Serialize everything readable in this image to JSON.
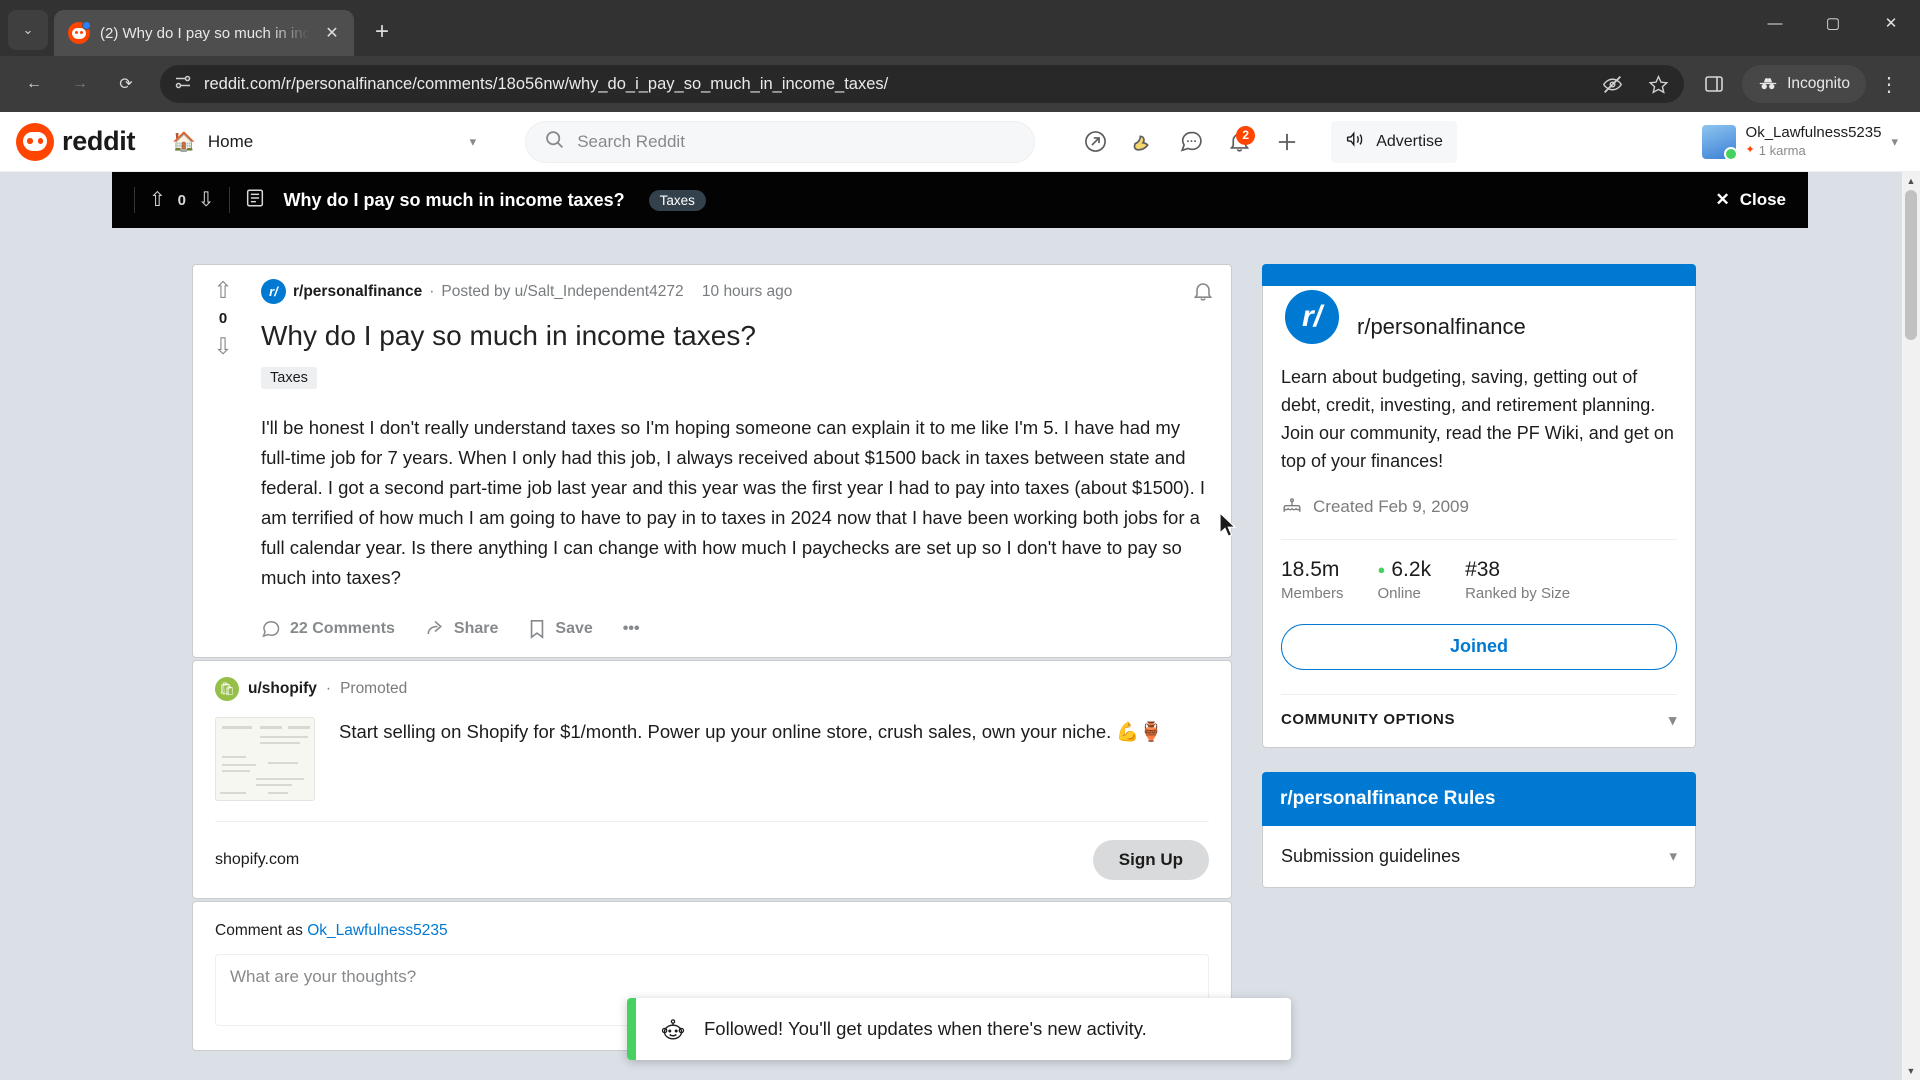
{
  "browser": {
    "tab": {
      "title": "(2) Why do I pay so much in inc",
      "close_label": "✕",
      "favicon": "reddit-favicon"
    },
    "new_tab_label": "+",
    "tab_list_label": "⌄",
    "window": {
      "minimize": "—",
      "maximize": "▢",
      "close": "✕"
    },
    "nav": {
      "back": "←",
      "forward": "→",
      "reload": "⟳"
    },
    "omnibox": {
      "url": "reddit.com/r/personalfinance/comments/18o56nw/why_do_i_pay_so_much_in_income_taxes/",
      "site_info_icon": "page-settings-icon",
      "tracking_icon": "eye-off-icon",
      "bookmark_icon": "star-icon"
    },
    "side_panel_label": "▮",
    "incognito_label": "Incognito",
    "menu_label": "⋮"
  },
  "reddit": {
    "logo_text": "reddit",
    "home_label": "Home",
    "search_placeholder": "Search Reddit",
    "header_icons": [
      {
        "name": "popular-icon",
        "glyph": "↗"
      },
      {
        "name": "rpan-icon",
        "glyph": "📡"
      },
      {
        "name": "chat-icon",
        "glyph": "💬"
      },
      {
        "name": "notifications-icon",
        "glyph": "🔔",
        "badge": "2"
      },
      {
        "name": "create-post-icon",
        "glyph": "+"
      }
    ],
    "advertise_label": "Advertise",
    "user": {
      "name": "Ok_Lawfulness5235",
      "karma": "1 karma"
    }
  },
  "overlay": {
    "vote_up": "⇧",
    "vote_count": "0",
    "vote_down": "⇩",
    "post_icon": "post-icon",
    "title": "Why do I pay so much in income taxes?",
    "flair": "Taxes",
    "close_label": "Close",
    "close_icon": "✕"
  },
  "post": {
    "vote_up": "⇧",
    "score": "0",
    "vote_down": "⇩",
    "subreddit": "r/personalfinance",
    "posted_by": "Posted by u/Salt_Independent4272",
    "timestamp": "10 hours ago",
    "bell_icon": "bell-icon",
    "title": "Why do I pay so much in income taxes?",
    "flair": "Taxes",
    "text": "I'll be honest I don't really understand taxes so I'm hoping someone can explain it to me like I'm 5. I have had my full-time job for 7 years. When I only had this job, I always received about $1500 back in taxes between state and federal. I got a second part-time job last year and this year was the first year I had to pay into taxes (about $1500). I am terrified of how much I am going to have to pay in to taxes in 2024 now that I have been working both jobs for a full calendar year. Is there anything I can change with how much I paychecks are set up so I don't have to pay so much into taxes?",
    "actions": [
      {
        "name": "comments-action",
        "icon": "comment-icon",
        "label": "22 Comments"
      },
      {
        "name": "share-action",
        "icon": "share-icon",
        "label": "Share"
      },
      {
        "name": "save-action",
        "icon": "bookmark-icon",
        "label": "Save"
      },
      {
        "name": "more-action",
        "icon": "ellipsis-icon",
        "label": "•••"
      }
    ]
  },
  "promo": {
    "user": "u/shopify",
    "promoted_label": "Promoted",
    "copy": "Start selling on Shopify for $1/month. Power up your online store, crush sales, own your niche. 💪🏺",
    "url": "shopify.com",
    "cta": "Sign Up"
  },
  "comment_box": {
    "prefix": "Comment as",
    "user": "Ok_Lawfulness5235",
    "placeholder": "What are your thoughts?"
  },
  "sidebar": {
    "subreddit": "r/personalfinance",
    "sub_icon_text": "r/",
    "description": "Learn about budgeting, saving, getting out of debt, credit, investing, and retirement planning. Join our community, read the PF Wiki, and get on top of your finances!",
    "created_icon": "cake-icon",
    "created": "Created Feb 9, 2009",
    "stats": [
      {
        "value": "18.5m",
        "label": "Members",
        "dot": false
      },
      {
        "value": "6.2k",
        "label": "Online",
        "dot": true
      },
      {
        "value": "#38",
        "label": "Ranked by Size",
        "dot": false
      }
    ],
    "join_button": "Joined",
    "community_options": "COMMUNITY OPTIONS",
    "rules_title": "r/personalfinance Rules",
    "rules": [
      {
        "label": "Submission guidelines"
      }
    ]
  },
  "toast": {
    "icon": "snoo-icon",
    "message": "Followed! You'll get updates when there's new activity.",
    "accent_color": "#46d160"
  },
  "colors": {
    "reddit_orange": "#ff4500",
    "reddit_blue": "#0079d3",
    "page_bg": "#dae0e6",
    "overlay_bg": "#030303"
  }
}
